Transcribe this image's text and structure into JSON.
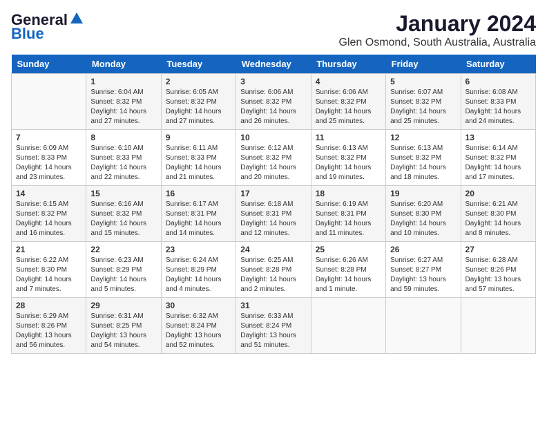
{
  "logo": {
    "general": "General",
    "blue": "Blue"
  },
  "title": "January 2024",
  "subtitle": "Glen Osmond, South Australia, Australia",
  "weekdays": [
    "Sunday",
    "Monday",
    "Tuesday",
    "Wednesday",
    "Thursday",
    "Friday",
    "Saturday"
  ],
  "weeks": [
    [
      {
        "day": "",
        "sunrise": "",
        "sunset": "",
        "daylight": ""
      },
      {
        "day": "1",
        "sunrise": "6:04 AM",
        "sunset": "8:32 PM",
        "daylight": "14 hours and 27 minutes."
      },
      {
        "day": "2",
        "sunrise": "6:05 AM",
        "sunset": "8:32 PM",
        "daylight": "14 hours and 27 minutes."
      },
      {
        "day": "3",
        "sunrise": "6:06 AM",
        "sunset": "8:32 PM",
        "daylight": "14 hours and 26 minutes."
      },
      {
        "day": "4",
        "sunrise": "6:06 AM",
        "sunset": "8:32 PM",
        "daylight": "14 hours and 25 minutes."
      },
      {
        "day": "5",
        "sunrise": "6:07 AM",
        "sunset": "8:32 PM",
        "daylight": "14 hours and 25 minutes."
      },
      {
        "day": "6",
        "sunrise": "6:08 AM",
        "sunset": "8:33 PM",
        "daylight": "14 hours and 24 minutes."
      }
    ],
    [
      {
        "day": "7",
        "sunrise": "6:09 AM",
        "sunset": "8:33 PM",
        "daylight": "14 hours and 23 minutes."
      },
      {
        "day": "8",
        "sunrise": "6:10 AM",
        "sunset": "8:33 PM",
        "daylight": "14 hours and 22 minutes."
      },
      {
        "day": "9",
        "sunrise": "6:11 AM",
        "sunset": "8:33 PM",
        "daylight": "14 hours and 21 minutes."
      },
      {
        "day": "10",
        "sunrise": "6:12 AM",
        "sunset": "8:32 PM",
        "daylight": "14 hours and 20 minutes."
      },
      {
        "day": "11",
        "sunrise": "6:13 AM",
        "sunset": "8:32 PM",
        "daylight": "14 hours and 19 minutes."
      },
      {
        "day": "12",
        "sunrise": "6:13 AM",
        "sunset": "8:32 PM",
        "daylight": "14 hours and 18 minutes."
      },
      {
        "day": "13",
        "sunrise": "6:14 AM",
        "sunset": "8:32 PM",
        "daylight": "14 hours and 17 minutes."
      }
    ],
    [
      {
        "day": "14",
        "sunrise": "6:15 AM",
        "sunset": "8:32 PM",
        "daylight": "14 hours and 16 minutes."
      },
      {
        "day": "15",
        "sunrise": "6:16 AM",
        "sunset": "8:32 PM",
        "daylight": "14 hours and 15 minutes."
      },
      {
        "day": "16",
        "sunrise": "6:17 AM",
        "sunset": "8:31 PM",
        "daylight": "14 hours and 14 minutes."
      },
      {
        "day": "17",
        "sunrise": "6:18 AM",
        "sunset": "8:31 PM",
        "daylight": "14 hours and 12 minutes."
      },
      {
        "day": "18",
        "sunrise": "6:19 AM",
        "sunset": "8:31 PM",
        "daylight": "14 hours and 11 minutes."
      },
      {
        "day": "19",
        "sunrise": "6:20 AM",
        "sunset": "8:30 PM",
        "daylight": "14 hours and 10 minutes."
      },
      {
        "day": "20",
        "sunrise": "6:21 AM",
        "sunset": "8:30 PM",
        "daylight": "14 hours and 8 minutes."
      }
    ],
    [
      {
        "day": "21",
        "sunrise": "6:22 AM",
        "sunset": "8:30 PM",
        "daylight": "14 hours and 7 minutes."
      },
      {
        "day": "22",
        "sunrise": "6:23 AM",
        "sunset": "8:29 PM",
        "daylight": "14 hours and 5 minutes."
      },
      {
        "day": "23",
        "sunrise": "6:24 AM",
        "sunset": "8:29 PM",
        "daylight": "14 hours and 4 minutes."
      },
      {
        "day": "24",
        "sunrise": "6:25 AM",
        "sunset": "8:28 PM",
        "daylight": "14 hours and 2 minutes."
      },
      {
        "day": "25",
        "sunrise": "6:26 AM",
        "sunset": "8:28 PM",
        "daylight": "14 hours and 1 minute."
      },
      {
        "day": "26",
        "sunrise": "6:27 AM",
        "sunset": "8:27 PM",
        "daylight": "13 hours and 59 minutes."
      },
      {
        "day": "27",
        "sunrise": "6:28 AM",
        "sunset": "8:26 PM",
        "daylight": "13 hours and 57 minutes."
      }
    ],
    [
      {
        "day": "28",
        "sunrise": "6:29 AM",
        "sunset": "8:26 PM",
        "daylight": "13 hours and 56 minutes."
      },
      {
        "day": "29",
        "sunrise": "6:31 AM",
        "sunset": "8:25 PM",
        "daylight": "13 hours and 54 minutes."
      },
      {
        "day": "30",
        "sunrise": "6:32 AM",
        "sunset": "8:24 PM",
        "daylight": "13 hours and 52 minutes."
      },
      {
        "day": "31",
        "sunrise": "6:33 AM",
        "sunset": "8:24 PM",
        "daylight": "13 hours and 51 minutes."
      },
      {
        "day": "",
        "sunrise": "",
        "sunset": "",
        "daylight": ""
      },
      {
        "day": "",
        "sunrise": "",
        "sunset": "",
        "daylight": ""
      },
      {
        "day": "",
        "sunrise": "",
        "sunset": "",
        "daylight": ""
      }
    ]
  ],
  "labels": {
    "sunrise": "Sunrise:",
    "sunset": "Sunset:",
    "daylight": "Daylight:"
  }
}
